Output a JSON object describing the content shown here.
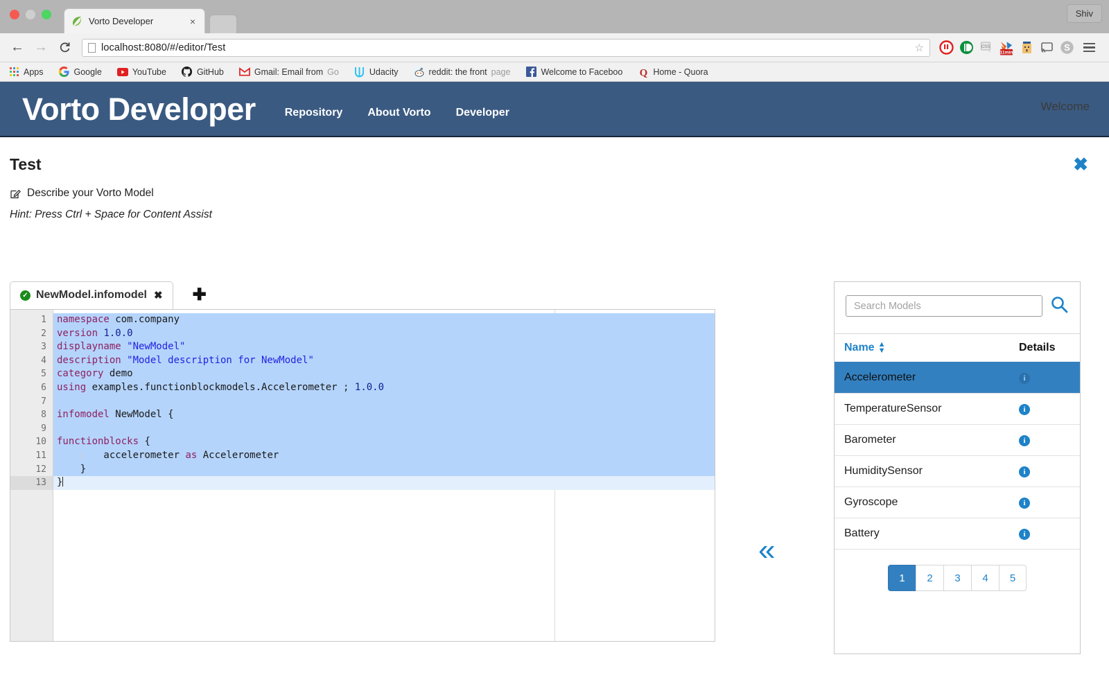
{
  "browser": {
    "tab": {
      "title": "Vorto Developer",
      "favicon": "leaf-icon",
      "close_label": "×"
    },
    "profile": "Shiv",
    "nav": {
      "back": "←",
      "forward": "→",
      "reload": "⟳"
    },
    "url": {
      "full": "localhost:8080/#/editor/Test",
      "host": "localhost",
      "rest": ":8080/#/editor/Test"
    },
    "star": "☆",
    "extensions": [
      "adblock-icon",
      "lastpass-icon",
      "css-icon",
      "firebug-icon",
      "pocket-icon",
      "cast-icon",
      "skype-icon"
    ],
    "bookmarks": [
      {
        "label": "Apps",
        "icon": "apps-grid-icon"
      },
      {
        "label": "Google",
        "icon": "google-icon"
      },
      {
        "label": "YouTube",
        "icon": "youtube-icon"
      },
      {
        "label": "GitHub",
        "icon": "github-icon"
      },
      {
        "label": "Gmail: Email from ",
        "truncated": "Go",
        "icon": "gmail-icon"
      },
      {
        "label": "Udacity",
        "icon": "udacity-icon"
      },
      {
        "label": "reddit: the front ",
        "truncated": "page",
        "icon": "reddit-icon"
      },
      {
        "label": "Welcome to Faceboo",
        "truncated": "",
        "icon": "facebook-icon"
      },
      {
        "label": "Home - Quora",
        "icon": "quora-icon"
      }
    ]
  },
  "header": {
    "brand": "Vorto Developer",
    "nav": [
      "Repository",
      "About Vorto",
      "Developer"
    ],
    "welcome": "Welcome",
    "brand_color": "#3a5a81"
  },
  "page": {
    "title": "Test",
    "close_label": "✖",
    "describe_label": "Describe your Vorto Model",
    "hint": "Hint: Press Ctrl + Space for Content Assist"
  },
  "editor": {
    "tab": {
      "name": "NewModel.infomodel",
      "status": "valid",
      "close_label": "✖"
    },
    "add_tab_label": "✚",
    "collapse_label": "«",
    "lines": [
      {
        "n": 1,
        "sel": true,
        "tokens": [
          {
            "c": "k",
            "t": "namespace"
          },
          {
            "c": "t",
            "t": " com.company"
          }
        ]
      },
      {
        "n": 2,
        "sel": true,
        "tokens": [
          {
            "c": "k",
            "t": "version"
          },
          {
            "c": "n",
            "t": " 1.0.0"
          }
        ]
      },
      {
        "n": 3,
        "sel": true,
        "tokens": [
          {
            "c": "k",
            "t": "displayname"
          },
          {
            "c": "s",
            "t": " \"NewModel\""
          }
        ]
      },
      {
        "n": 4,
        "sel": true,
        "tokens": [
          {
            "c": "k",
            "t": "description"
          },
          {
            "c": "s",
            "t": " \"Model description for NewModel\""
          }
        ]
      },
      {
        "n": 5,
        "sel": true,
        "tokens": [
          {
            "c": "k",
            "t": "category"
          },
          {
            "c": "t",
            "t": " demo"
          }
        ]
      },
      {
        "n": 6,
        "sel": true,
        "tokens": [
          {
            "c": "k",
            "t": "using"
          },
          {
            "c": "t",
            "t": " examples.functionblockmodels.Accelerometer ; "
          },
          {
            "c": "n",
            "t": "1.0.0"
          }
        ]
      },
      {
        "n": 7,
        "sel": true,
        "tokens": []
      },
      {
        "n": 8,
        "sel": true,
        "tokens": [
          {
            "c": "k",
            "t": "infomodel"
          },
          {
            "c": "t",
            "t": " NewModel {"
          }
        ]
      },
      {
        "n": 9,
        "sel": true,
        "tokens": []
      },
      {
        "n": 10,
        "sel": true,
        "tokens": [
          {
            "c": "k",
            "t": "functionblocks"
          },
          {
            "c": "t",
            "t": " {"
          }
        ]
      },
      {
        "n": 11,
        "sel": true,
        "tokens": [
          {
            "c": "t",
            "t": "        accelerometer "
          },
          {
            "c": "k",
            "t": "as"
          },
          {
            "c": "t",
            "t": " Accelerometer"
          }
        ]
      },
      {
        "n": 12,
        "sel": true,
        "tokens": [
          {
            "c": "t",
            "t": "    }"
          }
        ]
      },
      {
        "n": 13,
        "sel": false,
        "cur": true,
        "tokens": [
          {
            "c": "t",
            "t": "}"
          }
        ]
      }
    ]
  },
  "models_panel": {
    "search": {
      "placeholder": "Search Models",
      "value": "",
      "icon": "search-icon"
    },
    "columns": {
      "name": "Name",
      "details": "Details"
    },
    "sort_icon": "sort-arrows-icon",
    "rows": [
      {
        "name": "Accelerometer",
        "details": "info-icon",
        "selected": true
      },
      {
        "name": "TemperatureSensor",
        "details": "info-icon",
        "selected": false
      },
      {
        "name": "Barometer",
        "details": "info-icon",
        "selected": false
      },
      {
        "name": "HumiditySensor",
        "details": "info-icon",
        "selected": false
      },
      {
        "name": "Gyroscope",
        "details": "info-icon",
        "selected": false
      },
      {
        "name": "Battery",
        "details": "info-icon",
        "selected": false
      }
    ],
    "pages": [
      "1",
      "2",
      "3",
      "4",
      "5"
    ],
    "active_page": "1",
    "accent_color": "#3380c0",
    "link_color": "#1e82c8"
  }
}
